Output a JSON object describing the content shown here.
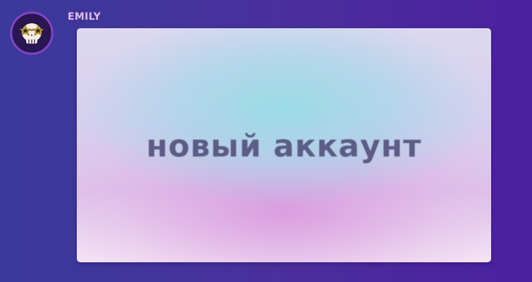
{
  "user": {
    "name": "EMILY",
    "avatar_icon": "skull-star-glasses-icon"
  },
  "card": {
    "text": "новый аккаунт"
  },
  "colors": {
    "background_left": "#3a3a9a",
    "background_right": "#4c1fa0",
    "username": "#e3b9f2",
    "card_text": "#55527d"
  }
}
